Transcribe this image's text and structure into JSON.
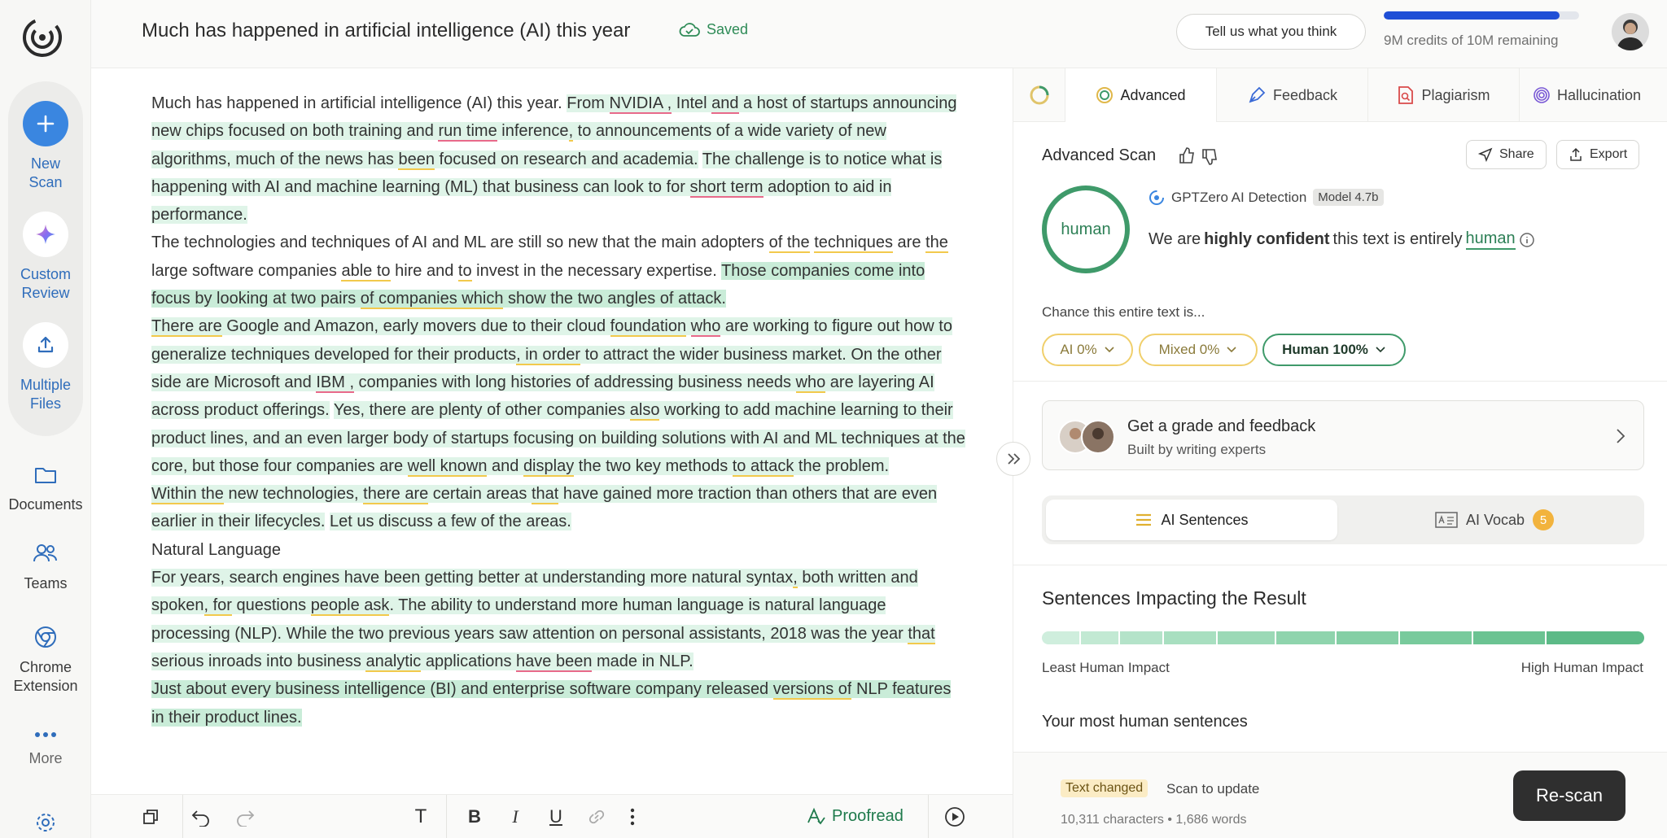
{
  "sidebar": {
    "actions": [
      {
        "label": "New\nScan",
        "icon": "plus-icon"
      },
      {
        "label": "Custom\nReview",
        "icon": "sparkle-icon"
      },
      {
        "label": "Multiple\nFiles",
        "icon": "upload-icon"
      }
    ],
    "nav": [
      {
        "label": "Documents",
        "icon": "folder-icon"
      },
      {
        "label": "Teams",
        "icon": "people-icon"
      },
      {
        "label": "Chrome\nExtension",
        "icon": "chrome-icon"
      },
      {
        "label": "More",
        "icon": "more-dots-icon"
      }
    ]
  },
  "header": {
    "doc_title": "Much has happened in artificial intelligence (AI) this year",
    "saved_label": "Saved",
    "feedback_label": "Tell us what you think",
    "credits_text": "9M credits of 10M remaining",
    "credits_fraction": 0.9
  },
  "editor": {
    "paragraphs": [
      [
        {
          "t": "Much has happened in artificial intelligence (AI) this year. "
        },
        {
          "t": "From ",
          "c": "hl"
        },
        {
          "t": "NVIDIA ,",
          "c": "hl ur"
        },
        {
          "t": " Intel ",
          "c": "hl"
        },
        {
          "t": "and",
          "c": "hl ur"
        },
        {
          "t": " a host of startups announcing new chips focused on both training and ",
          "c": "hl"
        },
        {
          "t": "run time",
          "c": "hl ur"
        },
        {
          "t": " inference",
          "c": "hl"
        },
        {
          "t": ",",
          "c": "hl uy"
        },
        {
          "t": " to announcements of a wide variety of new algorithms, much of the news has ",
          "c": "hl"
        },
        {
          "t": "been",
          "c": "hl uy"
        },
        {
          "t": " focused on research and academia.",
          "c": "hl"
        },
        {
          "t": " "
        },
        {
          "t": "The challenge is to notice what is happening with AI and machine learning (ML) that business can look to for ",
          "c": "hl"
        },
        {
          "t": "short term",
          "c": "hl ur"
        },
        {
          "t": " adoption to aid in performance.",
          "c": "hl"
        }
      ],
      [
        {
          "t": "The technologies and techniques of AI and ML are still so new that the main adopters "
        },
        {
          "t": "of the",
          "c": "uy"
        },
        {
          "t": " "
        },
        {
          "t": "techniques",
          "c": "uy"
        },
        {
          "t": " are "
        },
        {
          "t": "the",
          "c": "uy"
        },
        {
          "t": " large software companies "
        },
        {
          "t": "able to",
          "c": "uy"
        },
        {
          "t": " hire and "
        },
        {
          "t": "to",
          "c": "uy"
        },
        {
          "t": " invest in the necessary expertise. "
        },
        {
          "t": "Those companies come into focus by looking at two pairs ",
          "c": "hs"
        },
        {
          "t": "of companies which",
          "c": "hs uy"
        },
        {
          "t": " show the two angles of attack.",
          "c": "hs"
        }
      ],
      [
        {
          "t": "There are",
          "c": "hl uy"
        },
        {
          "t": " Google and Amazon, early movers due to their cloud ",
          "c": "hl"
        },
        {
          "t": "foundation",
          "c": "hl uy"
        },
        {
          "t": " ",
          "c": "hl"
        },
        {
          "t": "who",
          "c": "hl ur"
        },
        {
          "t": " are working to figure out how to generalize techniques developed for their products",
          "c": "hl"
        },
        {
          "t": ", in order",
          "c": "hl uy"
        },
        {
          "t": " to attract the wider business market. On the other side are Microsoft and ",
          "c": "hl"
        },
        {
          "t": "IBM ,",
          "c": "hl ur"
        },
        {
          "t": " companies with long histories of addressing business needs ",
          "c": "hl"
        },
        {
          "t": "who",
          "c": "hl uy"
        },
        {
          "t": " are layering AI across product offerings.",
          "c": "hl"
        },
        {
          "t": " "
        },
        {
          "t": "Yes, there are plenty of other companies ",
          "c": "hl"
        },
        {
          "t": "also",
          "c": "hl uy"
        },
        {
          "t": " working to add machine learning to their product lines, and an even larger body of startups focusing on building solutions with AI and ML techniques at the core, but those four companies are ",
          "c": "hl"
        },
        {
          "t": "well known",
          "c": "hl uy"
        },
        {
          "t": " and ",
          "c": "hl"
        },
        {
          "t": "display",
          "c": "hl uy"
        },
        {
          "t": " the two key methods ",
          "c": "hl"
        },
        {
          "t": "to attack",
          "c": "hl uy"
        },
        {
          "t": " the problem.",
          "c": "hl"
        }
      ],
      [
        {
          "t": "Within the",
          "c": "hl uy"
        },
        {
          "t": " new technologies, ",
          "c": "hl"
        },
        {
          "t": "there are",
          "c": "hl uy"
        },
        {
          "t": " certain areas ",
          "c": "hl"
        },
        {
          "t": "that",
          "c": "hl uy"
        },
        {
          "t": " have gained more traction than others that are even earlier in their lifecycles.",
          "c": "hl"
        },
        {
          "t": " "
        },
        {
          "t": "Let us discuss a few of the areas.",
          "c": "hl"
        }
      ],
      [
        {
          "t": "Natural Language"
        }
      ],
      [
        {
          "t": "For years, search engines have been getting better at understanding more natural syntax",
          "c": "hl"
        },
        {
          "t": ",",
          "c": "hl uy"
        },
        {
          "t": " both written and spoken",
          "c": "hl"
        },
        {
          "t": ", for",
          "c": "hl uy"
        },
        {
          "t": " questions ",
          "c": "hl"
        },
        {
          "t": "people ask",
          "c": "hl uy"
        },
        {
          "t": ". The ability to understand more human language is natural language processing (NLP). While the two previous years saw attention on personal assistants, 2018 was the year ",
          "c": "hl"
        },
        {
          "t": "that",
          "c": "hl uy"
        },
        {
          "t": " serious inroads into business ",
          "c": "hl"
        },
        {
          "t": "analytic",
          "c": "hl uy"
        },
        {
          "t": " applications ",
          "c": "hl"
        },
        {
          "t": "have been",
          "c": "hl ur"
        },
        {
          "t": " made in NLP.",
          "c": "hl"
        }
      ],
      [
        {
          "t": "Just about every business intelligence (BI) and enterprise software company released ",
          "c": "hs"
        },
        {
          "t": "versions of",
          "c": "hs uy"
        },
        {
          "t": " NLP features in their product lines.",
          "c": "hs"
        }
      ]
    ]
  },
  "toolbar": {
    "proofread_label": "Proofread"
  },
  "panel": {
    "tabs": [
      {
        "label": "Advanced",
        "icon": "advanced-scan-icon"
      },
      {
        "label": "Feedback",
        "icon": "pen-icon"
      },
      {
        "label": "Plagiarism",
        "icon": "document-search-icon"
      },
      {
        "label": "Hallucination",
        "icon": "fingerprint-icon"
      }
    ],
    "title": "Advanced Scan",
    "share_label": "Share",
    "export_label": "Export",
    "gauge_label": "human",
    "detector_label": "GPTZero AI Detection",
    "model_label": "Model 4.7b",
    "confidence": {
      "pre": "We are ",
      "bold": "highly confident",
      "mid": " this text is entirely ",
      "word": "human"
    },
    "chance_label": "Chance this entire text is...",
    "pills": [
      {
        "label": "AI 0%",
        "border": "#f0cf6b",
        "color": "#8a7a3a"
      },
      {
        "label": "Mixed 0%",
        "border": "#f0cf6b",
        "color": "#8a7a3a"
      },
      {
        "label": "Human 100%",
        "border": "#3f9a6a",
        "color": "#1f3a2a"
      }
    ],
    "grade_title": "Get a grade and feedback",
    "grade_sub": "Built by writing experts",
    "seg": {
      "sentences": "AI Sentences",
      "vocab": "AI Vocab",
      "vocab_count": "5"
    },
    "impact_title": "Sentences Impacting the Result",
    "impact_low": "Least Human Impact",
    "impact_high": "High Human Impact",
    "most_human": "Your most human sentences",
    "text_changed": "Text changed",
    "scan_update": "Scan to update",
    "stats": "10,311 characters • 1,686 words",
    "rescan_label": "Re-scan",
    "colors": {
      "accent_green": "#3f9a6a",
      "credits_blue": "#1f4fd6",
      "highlight": "#dff4e8"
    }
  }
}
